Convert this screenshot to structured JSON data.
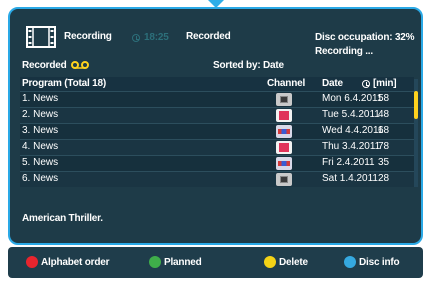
{
  "header": {
    "mode_label": "Recording",
    "time": "18:25",
    "recorded_label": "Recorded",
    "disc_occupation": "Disc occupation: 32%",
    "recording_status": "Recording ...",
    "filter_label": "Recorded",
    "sorted_by": "Sorted by: Date"
  },
  "table": {
    "columns": {
      "program": "Program (Total 18)",
      "channel": "Channel",
      "date": "Date",
      "duration": "[min]"
    },
    "rows": [
      {
        "title": "1. News",
        "channel_icon": "gray-channel-icon",
        "date": "Mon 6.4.2011",
        "duration": "58"
      },
      {
        "title": "2. News",
        "channel_icon": "red-channel-icon",
        "date": "Tue 5.4.2011",
        "duration": "48"
      },
      {
        "title": "3. News",
        "channel_icon": "blue-channel-icon",
        "date": "Wed 4.4.2011",
        "duration": "68"
      },
      {
        "title": "4. News",
        "channel_icon": "red-channel-icon",
        "date": "Thu 3.4.2011",
        "duration": "78"
      },
      {
        "title": "5. News",
        "channel_icon": "blue-channel-icon",
        "date": "Fri 2.4.2011",
        "duration": "35"
      },
      {
        "title": "6. News",
        "channel_icon": "gray-channel-icon",
        "date": "Sat 1.4.2011",
        "duration": "28"
      }
    ]
  },
  "description": "American Thriller.",
  "buttons": {
    "red": "Alphabet order",
    "green": "Planned",
    "yellow": "Delete",
    "blue": "Disc info"
  },
  "colors": {
    "accent": "#2aa9e6",
    "panel": "#1e3b48",
    "yellow": "#ffd21e",
    "red_key": "#e8252e",
    "green_key": "#3fae4a",
    "yellow_key": "#f4d316",
    "blue_key": "#35a9e0"
  }
}
